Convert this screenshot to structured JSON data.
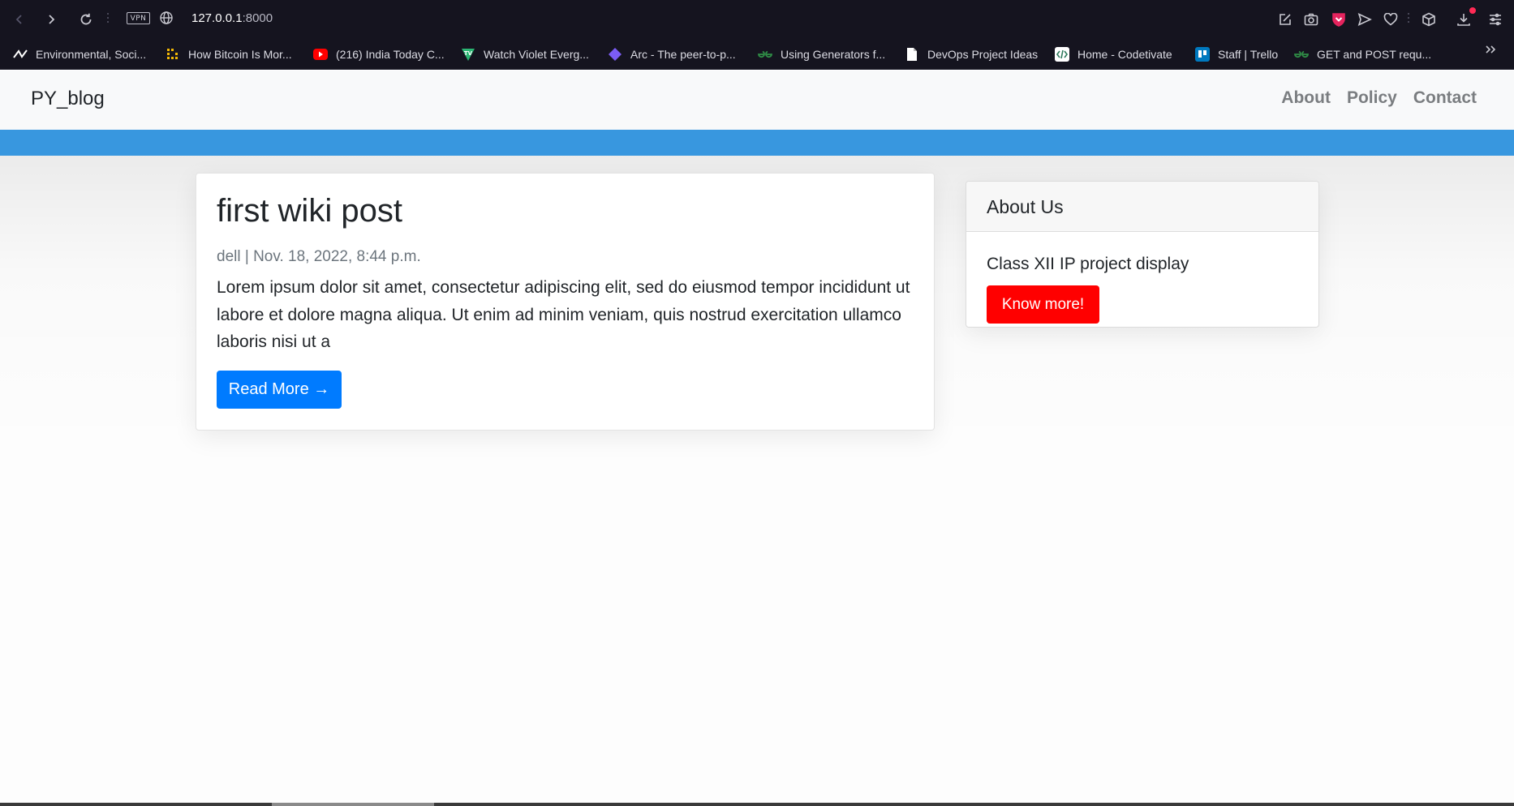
{
  "browser": {
    "url_host": "127.0.0.1",
    "url_port": ":8000",
    "vpn_label": "VPN",
    "bookmarks": [
      {
        "label": "Environmental, Soci...",
        "icon": "zigzag-logo-icon",
        "color": "#ffffff"
      },
      {
        "label": "How Bitcoin Is Mor...",
        "icon": "grid-logo-icon",
        "color": "#f2b705"
      },
      {
        "label": "(216) India Today C...",
        "icon": "youtube-icon",
        "color": "#ff0000"
      },
      {
        "label": "Watch Violet Everg...",
        "icon": "tv-shield-icon",
        "color": "#2bb673"
      },
      {
        "label": "Arc - The peer-to-p...",
        "icon": "diamond-icon",
        "color": "#7b5cf5"
      },
      {
        "label": "Using Generators f...",
        "icon": "gfg-icon",
        "color": "#2f8d46"
      },
      {
        "label": "DevOps Project Ideas",
        "icon": "document-icon",
        "color": "#ffffff"
      },
      {
        "label": "Home - Codetivate",
        "icon": "code-icon",
        "color": "#ffffff"
      },
      {
        "label": "Staff | Trello",
        "icon": "trello-icon",
        "color": "#0079bf"
      },
      {
        "label": "GET and POST requ...",
        "icon": "gfg-icon",
        "color": "#2f8d46"
      }
    ]
  },
  "site": {
    "brand": "PY_blog",
    "nav": [
      "About",
      "Policy",
      "Contact"
    ],
    "accent_color": "#3897df"
  },
  "post": {
    "title": "first wiki post",
    "meta": "dell | Nov. 18, 2022, 8:44 p.m.",
    "excerpt": "Lorem ipsum dolor sit amet, consectetur adipiscing elit, sed do eiusmod tempor incididunt ut labore et dolore magna aliqua. Ut enim ad minim veniam, quis nostrud exercitation ullamco laboris nisi ut a",
    "read_more_label": "Read More →",
    "button_color": "#007bff"
  },
  "sidebar": {
    "heading": "About Us",
    "text": "Class XII IP project display",
    "button_label": "Know more!",
    "button_color": "#ff0000"
  }
}
